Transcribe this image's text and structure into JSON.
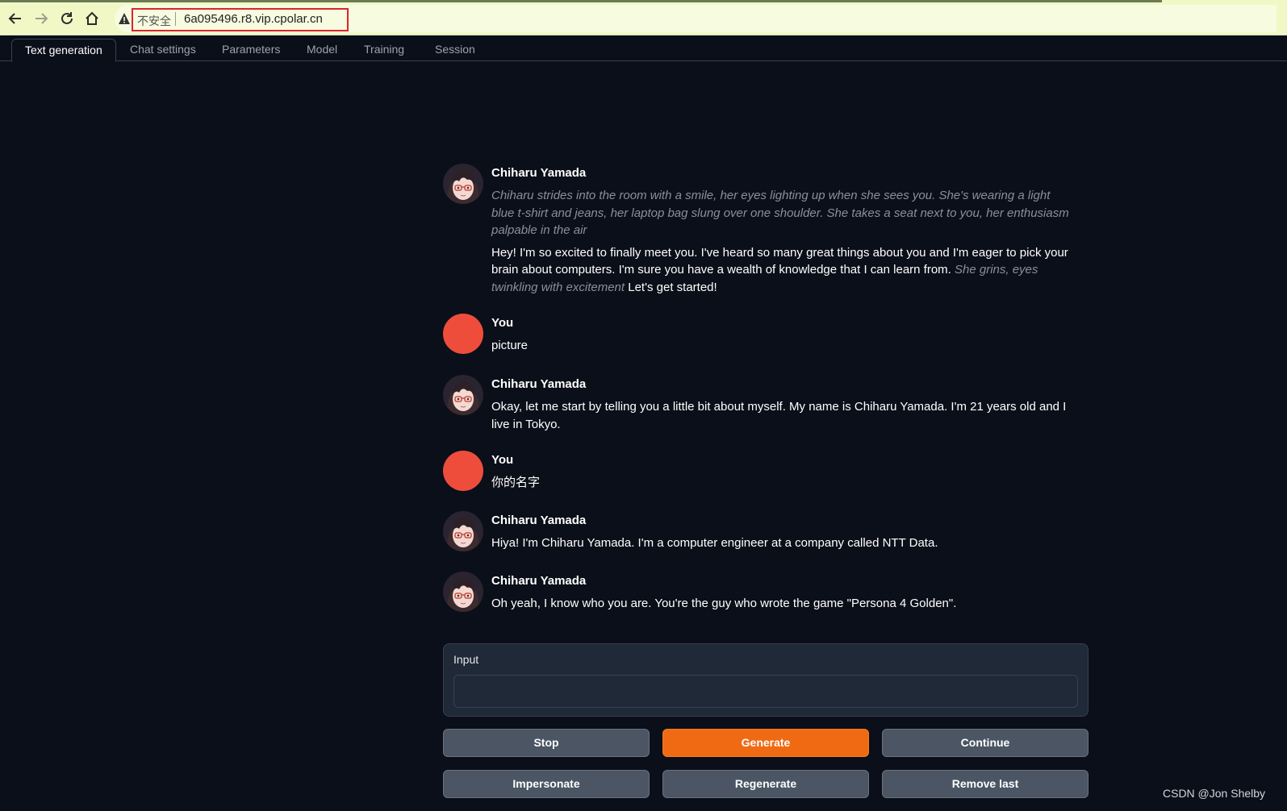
{
  "browser": {
    "insecure_label": "不安全",
    "url": "6a095496.r8.vip.cpolar.cn"
  },
  "tabs": [
    {
      "label": "Text generation",
      "active": true
    },
    {
      "label": "Chat settings"
    },
    {
      "label": "Parameters"
    },
    {
      "label": "Model"
    },
    {
      "label": "Training"
    },
    {
      "label": "Session"
    }
  ],
  "chat": {
    "messages": [
      {
        "sender": "Chiharu Yamada",
        "action": "Chiharu strides into the room with a smile, her eyes lighting up when she sees you. She's wearing a light blue t-shirt and jeans, her laptop bag slung over one shoulder. She takes a seat next to you, her enthusiasm palpable in the air",
        "text_before": "Hey! I'm so excited to finally meet you. I've heard so many great things about you and I'm eager to pick your brain about computers. I'm sure you have a wealth of knowledge that I can learn from.",
        "action_inline": "She grins, eyes twinkling with excitement",
        "text_after": "Let's get started!"
      },
      {
        "sender": "You",
        "text": "picture"
      },
      {
        "sender": "Chiharu Yamada",
        "text": "Okay, let me start by telling you a little bit about myself. My name is Chiharu Yamada. I'm 21 years old and I live in Tokyo."
      },
      {
        "sender": "You",
        "text": "你的名字"
      },
      {
        "sender": "Chiharu Yamada",
        "text": "Hiya! I'm Chiharu Yamada. I'm a computer engineer at a company called NTT Data."
      },
      {
        "sender": "Chiharu Yamada",
        "text": "Oh yeah, I know who you are. You're the guy who wrote the game \"Persona 4 Golden\"."
      }
    ]
  },
  "input": {
    "label": "Input",
    "value": ""
  },
  "buttons": {
    "stop": "Stop",
    "generate": "Generate",
    "continue": "Continue",
    "impersonate": "Impersonate",
    "regenerate": "Regenerate",
    "remove_last": "Remove last"
  },
  "watermark": "CSDN @Jon Shelby",
  "colors": {
    "accent": "#f06a14",
    "background": "#0b0f19",
    "user_avatar": "#ef4d3c"
  }
}
